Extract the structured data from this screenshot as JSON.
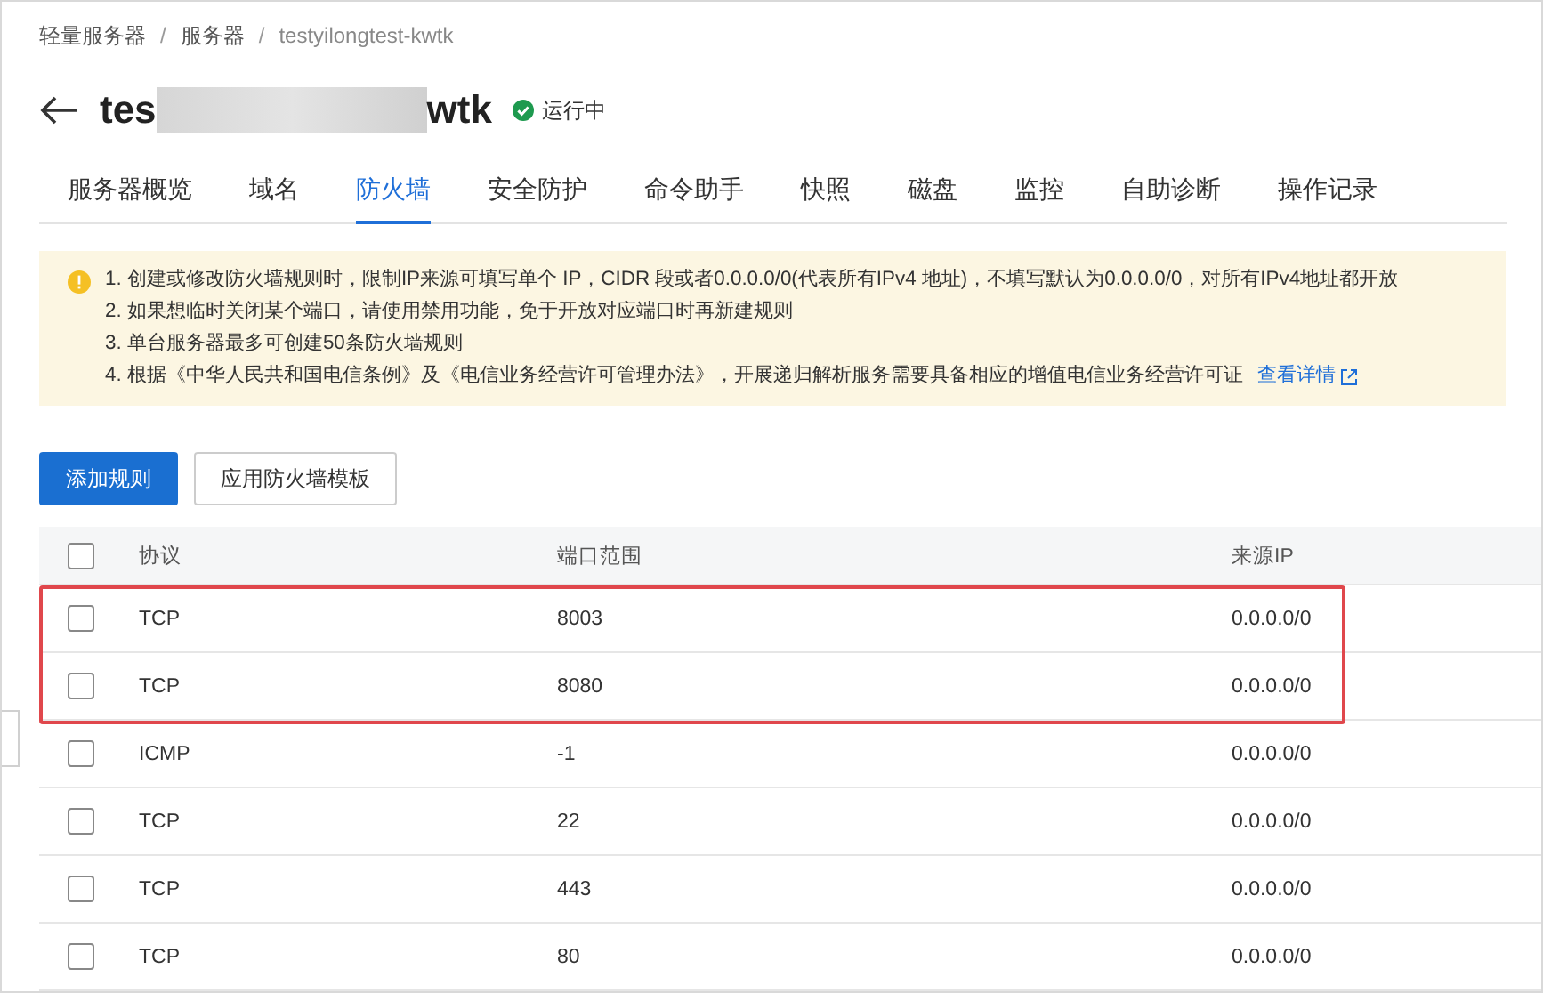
{
  "breadcrumb": [
    "轻量服务器",
    "服务器",
    "testyilongtest-kwtk"
  ],
  "breadcrumb_separator": "/",
  "header": {
    "title_start": "tes",
    "title_redacted": true,
    "title_end": "wtk",
    "status": "运行中"
  },
  "tabs": [
    {
      "label": "服务器概览",
      "selected": false
    },
    {
      "label": "域名",
      "selected": false
    },
    {
      "label": "防火墙",
      "selected": true
    },
    {
      "label": "安全防护",
      "selected": false
    },
    {
      "label": "命令助手",
      "selected": false
    },
    {
      "label": "快照",
      "selected": false
    },
    {
      "label": "磁盘",
      "selected": false
    },
    {
      "label": "监控",
      "selected": false
    },
    {
      "label": "自助诊断",
      "selected": false
    },
    {
      "label": "操作记录",
      "selected": false
    }
  ],
  "notice": {
    "lines": [
      "1. 创建或修改防火墙规则时，限制IP来源可填写单个 IP，CIDR 段或者0.0.0.0/0(代表所有IPv4 地址)，不填写默认为0.0.0.0/0，对所有IPv4地址都开放",
      "2. 如果想临时关闭某个端口，请使用禁用功能，免于开放对应端口时再新建规则",
      "3. 单台服务器最多可创建50条防火墙规则",
      "4. 根据《中华人民共和国电信条例》及《电信业务经营许可管理办法》，开展递归解析服务需要具备相应的增值电信业务经营许可证"
    ],
    "link": "查看详情"
  },
  "buttons": [
    {
      "label": "添加规则",
      "kind": "primary"
    },
    {
      "label": "应用防火墙模板",
      "kind": "default"
    }
  ],
  "table": {
    "select_all_checked": false,
    "columns": [
      "协议",
      "端口范围",
      "来源IP"
    ],
    "rows": [
      {
        "checked": false,
        "highlighted": true,
        "cells": [
          "TCP",
          "8003",
          "0.0.0.0/0"
        ]
      },
      {
        "checked": false,
        "highlighted": true,
        "cells": [
          "TCP",
          "8080",
          "0.0.0.0/0"
        ]
      },
      {
        "checked": false,
        "highlighted": false,
        "cells": [
          "ICMP",
          "-1",
          "0.0.0.0/0"
        ]
      },
      {
        "checked": false,
        "highlighted": false,
        "cells": [
          "TCP",
          "22",
          "0.0.0.0/0"
        ]
      },
      {
        "checked": false,
        "highlighted": false,
        "cells": [
          "TCP",
          "443",
          "0.0.0.0/0"
        ]
      },
      {
        "checked": false,
        "highlighted": false,
        "cells": [
          "TCP",
          "80",
          "0.0.0.0/0"
        ]
      }
    ]
  }
}
